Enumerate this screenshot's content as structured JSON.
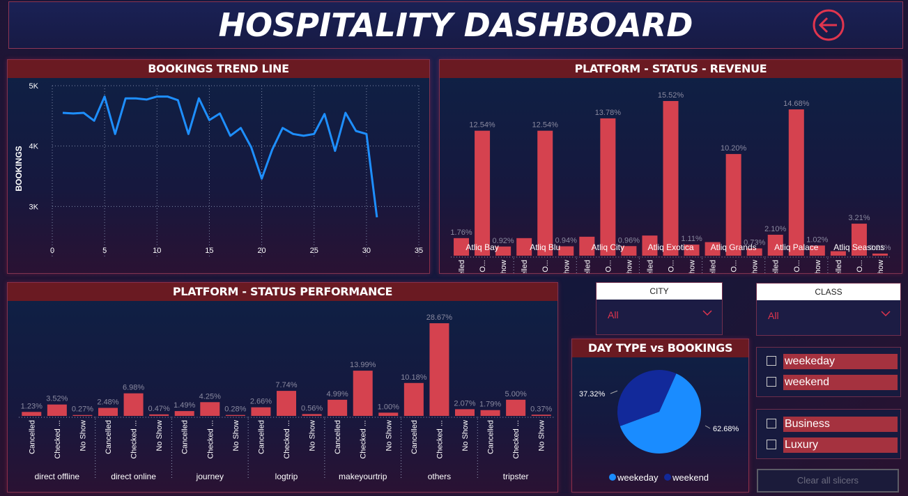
{
  "header": {
    "title": "HOSPITALITY DASHBOARD",
    "back_icon": "arrow-left-circle-icon",
    "accent": "#e0354e"
  },
  "trend": {
    "title": "BOOKINGS TREND LINE",
    "ylabel": "BOOKINGS",
    "line_color": "#1e8fff"
  },
  "revenue": {
    "title": "PLATFORM - STATUS - REVENUE",
    "bar_color": "#d5424f"
  },
  "performance": {
    "title": "PLATFORM - STATUS PERFORMANCE",
    "bar_color": "#d5424f"
  },
  "daytype": {
    "title": "DAY TYPE vs BOOKINGS",
    "colors": [
      "#1a8cff",
      "#12299a"
    ]
  },
  "filters": {
    "city": {
      "label": "CITY",
      "value": "All"
    },
    "class": {
      "label": "CLASS",
      "value": "All"
    },
    "day_options": [
      "weekeday",
      "weekend"
    ],
    "room_options": [
      "Business",
      "Luxury"
    ],
    "clear_label": "Clear all slicers"
  },
  "chart_data": [
    {
      "type": "line",
      "title": "BOOKINGS TREND LINE",
      "ylabel": "BOOKINGS",
      "x_ticks": [
        "0",
        "5",
        "10",
        "15",
        "20",
        "25",
        "30",
        "35"
      ],
      "y_ticks": [
        "3K",
        "4K",
        "5K"
      ],
      "xlim": [
        0,
        35
      ],
      "ylim": [
        2750,
        5000
      ],
      "grid": true,
      "x": [
        1,
        2,
        3,
        4,
        5,
        6,
        7,
        8,
        9,
        10,
        11,
        12,
        13,
        14,
        15,
        16,
        17,
        18,
        19,
        20,
        21,
        22,
        23,
        24,
        25,
        26,
        27,
        28,
        29,
        30,
        31
      ],
      "y": [
        4550,
        4540,
        4550,
        4420,
        4820,
        4200,
        4790,
        4790,
        4770,
        4820,
        4820,
        4760,
        4200,
        4790,
        4430,
        4540,
        4170,
        4300,
        3980,
        3460,
        3940,
        4300,
        4200,
        4170,
        4200,
        4530,
        3920,
        4550,
        4250,
        4200,
        2820
      ]
    },
    {
      "type": "bar",
      "title": "PLATFORM - STATUS - REVENUE",
      "groups": [
        "Atliq Bay",
        "Atliq Blu",
        "Atliq City",
        "Atliq Exotica",
        "Atliq Grands",
        "Atliq Palace",
        "Atliq Seasons"
      ],
      "statuses": [
        "Cancelled",
        "Checked O...",
        "No Show"
      ],
      "values": [
        [
          1.76,
          12.54,
          0.92
        ],
        [
          1.76,
          12.54,
          0.94
        ],
        [
          1.9,
          13.78,
          0.96
        ],
        [
          2.02,
          15.52,
          1.11
        ],
        [
          1.36,
          10.2,
          0.73
        ],
        [
          2.1,
          14.68,
          1.02
        ],
        [
          0.45,
          3.21,
          0.21
        ]
      ],
      "labels": [
        [
          "1.76%",
          "12.54%",
          "0.92%"
        ],
        [
          "",
          "12.54%",
          "0.94%"
        ],
        [
          "",
          "13.78%",
          "0.96%"
        ],
        [
          "",
          "15.52%",
          "1.11%"
        ],
        [
          "",
          "10.20%",
          "0.73%"
        ],
        [
          "2.10%",
          "14.68%",
          "1.02%"
        ],
        [
          "",
          "3.21%",
          "0.21%"
        ]
      ]
    },
    {
      "type": "bar",
      "title": "PLATFORM - STATUS PERFORMANCE",
      "groups": [
        "direct offline",
        "direct online",
        "journey",
        "logtrip",
        "makeyourtrip",
        "others",
        "tripster"
      ],
      "statuses": [
        "Cancelled",
        "Checked ...",
        "No Show"
      ],
      "values": [
        [
          1.23,
          3.52,
          0.27
        ],
        [
          2.48,
          6.98,
          0.47
        ],
        [
          1.49,
          4.25,
          0.28
        ],
        [
          2.66,
          7.74,
          0.56
        ],
        [
          4.99,
          13.99,
          1.0
        ],
        [
          10.18,
          28.67,
          2.07
        ],
        [
          1.79,
          5.0,
          0.37
        ]
      ],
      "labels": [
        [
          "1.23%",
          "3.52%",
          "0.27%"
        ],
        [
          "2.48%",
          "6.98%",
          "0.47%"
        ],
        [
          "1.49%",
          "4.25%",
          "0.28%"
        ],
        [
          "2.66%",
          "7.74%",
          "0.56%"
        ],
        [
          "4.99%",
          "13.99%",
          "1.00%"
        ],
        [
          "10.18%",
          "28.67%",
          "2.07%"
        ],
        [
          "1.79%",
          "5.00%",
          "0.37%"
        ]
      ]
    },
    {
      "type": "pie",
      "title": "DAY TYPE vs BOOKINGS",
      "categories": [
        "weekeday",
        "weekend"
      ],
      "values": [
        62.68,
        37.32
      ],
      "labels": [
        "62.68%",
        "37.32%"
      ],
      "legend": "bottom"
    }
  ]
}
